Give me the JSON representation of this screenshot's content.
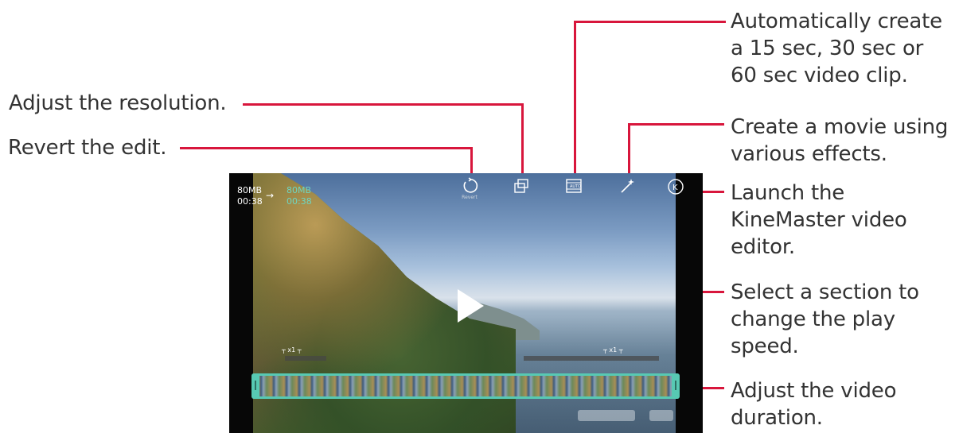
{
  "callouts": {
    "auto_clip": "Automatically create\na 15 sec, 30 sec or\n60 sec video clip.",
    "resolution": "Adjust the resolution.",
    "revert": "Revert the edit.",
    "movie": "Create a movie using\nvarious effects.",
    "kinemaster": "Launch the\nKineMaster video\neditor.",
    "speed": "Select a section to\nchange the play\nspeed.",
    "duration": "Adjust the video\nduration."
  },
  "screen": {
    "size_old": "80MB",
    "time_old": "00:38",
    "arrow": "→",
    "size_new": "80MB",
    "time_new": "00:38",
    "speed_left": "x1",
    "speed_right": "x1",
    "tools": [
      {
        "icon": "revert-icon",
        "label": "Revert"
      },
      {
        "icon": "resolution-icon",
        "label": ""
      },
      {
        "icon": "auto-clip-icon",
        "label": ""
      },
      {
        "icon": "magic-wand-icon",
        "label": ""
      },
      {
        "icon": "kinemaster-icon",
        "label": ""
      }
    ]
  },
  "colors": {
    "leader": "#d8163c",
    "timeline_accent": "#57c9b3"
  }
}
